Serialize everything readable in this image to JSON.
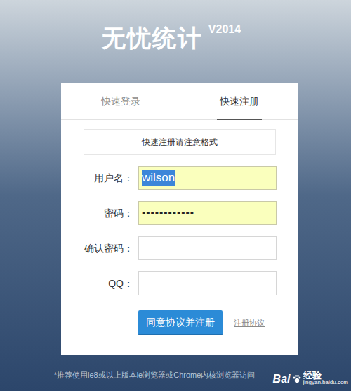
{
  "title": "无忧统计",
  "version": "V2014",
  "tabs": [
    {
      "label": "快速登录",
      "selected": false
    },
    {
      "label": "快速注册",
      "selected": true
    }
  ],
  "notice": "快速注册请注意格式",
  "fields": [
    {
      "label": "用户名：",
      "value": "wilson",
      "kind": "text",
      "autofilled": true,
      "text_selected": true
    },
    {
      "label": "密码：",
      "value": "••••••••••••",
      "kind": "password",
      "autofilled": true,
      "text_selected": false
    },
    {
      "label": "确认密码：",
      "value": "",
      "kind": "password",
      "autofilled": false,
      "text_selected": false
    },
    {
      "label": "QQ：",
      "value": "",
      "kind": "text",
      "autofilled": false,
      "text_selected": false
    }
  ],
  "submit_button": "同意协议并注册",
  "agreement_link": "注册协议",
  "footer": "*推荐使用ie8或以上版本ie浏览器或Chrome内核浏览器访问",
  "watermark": {
    "brand": "Bai",
    "product": "经验",
    "url": "jingyan.baidu.com"
  }
}
